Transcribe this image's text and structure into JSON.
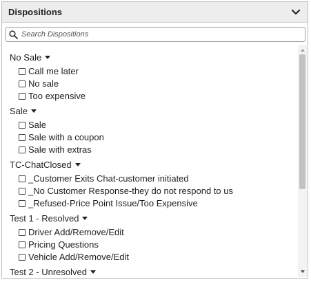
{
  "panel": {
    "title": "Dispositions",
    "collapse_icon": "chevron-down-icon"
  },
  "search": {
    "placeholder": "Search Dispositions",
    "value": "",
    "icon": "search-icon"
  },
  "groups": [
    {
      "label": "No Sale",
      "items": [
        "Call me later",
        "No sale",
        "Too expensive"
      ]
    },
    {
      "label": "Sale",
      "items": [
        "Sale",
        "Sale with a coupon",
        "Sale with extras"
      ]
    },
    {
      "label": "TC-ChatClosed",
      "items": [
        "_Customer Exits Chat-customer initiated",
        "_No Customer Response-they do not respond to us",
        "_Refused-Price Point Issue/Too Expensive"
      ]
    },
    {
      "label": "Test 1 - Resolved",
      "items": [
        "Driver Add/Remove/Edit",
        "Pricing Questions",
        "Vehicle Add/Remove/Edit"
      ]
    },
    {
      "label": "Test 2 - Unresolved",
      "items": []
    }
  ]
}
